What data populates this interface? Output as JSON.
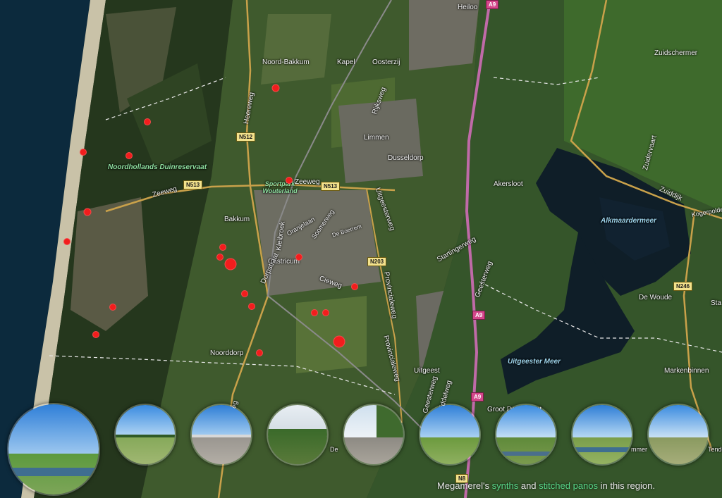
{
  "map": {
    "places": [
      "Heiloo",
      "Noord-Bakkum",
      "Kapel",
      "Oosterzij",
      "Limmen",
      "Dusseldorp",
      "Akersloot",
      "Zuidschermer",
      "Bakkum",
      "Castricum",
      "Noorddorp",
      "Uitgeest",
      "Groot Dorregeest",
      "De Woude",
      "Markenbinnen"
    ],
    "water": [
      "Alkmaardermeer",
      "Uitgeester Meer"
    ],
    "park": [
      "Noordhollands Duinreservaat",
      "Sportpark Wouterland"
    ],
    "streets": [
      "Heereweg",
      "Zeeweg",
      "Zeeweg",
      "Oranjelaan",
      "De Boerrem",
      "Kleibroek",
      "Soomerweg",
      "Dorpstraat",
      "Cieweg",
      "Rijksweg",
      "Uitgeesterweg",
      "Startingerweg",
      "Geesterweg",
      "Provincialeweg",
      "Provincialeweg",
      "Geesterweg",
      "Middelweg",
      "Zuidervaart",
      "Zuiddijk",
      "Kogerpolde",
      "raatweg",
      "Sta",
      "Tende",
      "mmer",
      "De"
    ],
    "roads": [
      "N512",
      "N513",
      "N513",
      "N203",
      "A9",
      "A9",
      "A9",
      "N246",
      "N8"
    ]
  },
  "pins": [
    {
      "id": "pin-1"
    },
    {
      "id": "pin-2"
    },
    {
      "id": "pin-3"
    },
    {
      "id": "pin-4"
    },
    {
      "id": "pin-5"
    },
    {
      "id": "pin-6"
    },
    {
      "id": "pin-7"
    },
    {
      "id": "pin-8"
    },
    {
      "id": "pin-9"
    },
    {
      "id": "pin-10"
    },
    {
      "id": "pin-11"
    },
    {
      "id": "pin-12"
    },
    {
      "id": "pin-13"
    },
    {
      "id": "pin-14"
    },
    {
      "id": "pin-15"
    },
    {
      "id": "pin-16"
    },
    {
      "id": "pin-17"
    },
    {
      "id": "pin-18"
    },
    {
      "id": "pin-19"
    },
    {
      "id": "pin-20"
    },
    {
      "id": "pin-21"
    },
    {
      "id": "pin-22"
    }
  ],
  "caption": {
    "owner": "Megamerel's",
    "link1": "synths",
    "and": "and",
    "link2": "stitched panos",
    "tail": "in this region."
  },
  "colors": {
    "pin": "#f21d1d",
    "link": "#59d98a",
    "sea": "#0c2a3d",
    "water": "#0f1e28",
    "motorway": "#c06aa8",
    "road": "#c9a14a"
  }
}
